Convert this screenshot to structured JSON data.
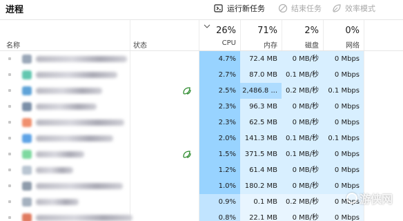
{
  "title": "进程",
  "toolbar": {
    "run_task": "运行新任务",
    "end_task": "结束任务",
    "efficiency_mode": "效率模式"
  },
  "columns": {
    "name": "名称",
    "status": "状态",
    "cpu": {
      "percent": "26%",
      "label": "CPU"
    },
    "memory": {
      "percent": "71%",
      "label": "内存"
    },
    "disk": {
      "percent": "2%",
      "label": "磁盘"
    },
    "network": {
      "percent": "0%",
      "label": "网络"
    }
  },
  "colors": {
    "cpu_high": "#98d3ff",
    "cpu_mid": "#c1e4ff",
    "cell_light": "#d8efff",
    "cell_lighter": "#e8f5ff",
    "memory_highlight": "#aedcff",
    "leaf_icon": "#2d8a2d"
  },
  "rows": [
    {
      "cpu": "4.7%",
      "memory": "72.4 MB",
      "disk": "0 MB/秒",
      "network": "0 Mbps",
      "status_icon": "",
      "icon_color": "#9aa7b8"
    },
    {
      "cpu": "2.7%",
      "memory": "87.0 MB",
      "disk": "0.1 MB/秒",
      "network": "0 Mbps",
      "status_icon": "",
      "icon_color": "#62c7b0"
    },
    {
      "cpu": "2.5%",
      "memory": "2,486.8 ...",
      "disk": "0.2 MB/秒",
      "network": "0.1 Mbps",
      "status_icon": "leaf-icon",
      "icon_color": "#5fa3d8"
    },
    {
      "cpu": "2.3%",
      "memory": "96.3 MB",
      "disk": "0 MB/秒",
      "network": "0 Mbps",
      "status_icon": "",
      "icon_color": "#7b8fa8"
    },
    {
      "cpu": "2.3%",
      "memory": "62.5 MB",
      "disk": "0 MB/秒",
      "network": "0 Mbps",
      "status_icon": "",
      "icon_color": "#f08f6e"
    },
    {
      "cpu": "2.0%",
      "memory": "141.3 MB",
      "disk": "0.1 MB/秒",
      "network": "0.1 Mbps",
      "status_icon": "",
      "icon_color": "#5ea3e6"
    },
    {
      "cpu": "1.5%",
      "memory": "371.5 MB",
      "disk": "0.1 MB/秒",
      "network": "0 Mbps",
      "status_icon": "leaf-icon",
      "icon_color": "#7ed9a0"
    },
    {
      "cpu": "1.2%",
      "memory": "61.4 MB",
      "disk": "0 MB/秒",
      "network": "0 Mbps",
      "status_icon": "",
      "icon_color": "#b9c5d2"
    },
    {
      "cpu": "1.0%",
      "memory": "180.2 MB",
      "disk": "0 MB/秒",
      "network": "0 Mbps",
      "status_icon": "",
      "icon_color": "#8e9bab"
    },
    {
      "cpu": "0.9%",
      "memory": "0.1 MB",
      "disk": "0.2 MB/秒",
      "network": "0 Mbps",
      "status_icon": "",
      "icon_color": "#a5b1bf"
    },
    {
      "cpu": "0.8%",
      "memory": "22.1 MB",
      "disk": "0 MB/秒",
      "network": "0 Mbps",
      "status_icon": "",
      "icon_color": "#e07a5f"
    }
  ],
  "watermark": "游侠网"
}
